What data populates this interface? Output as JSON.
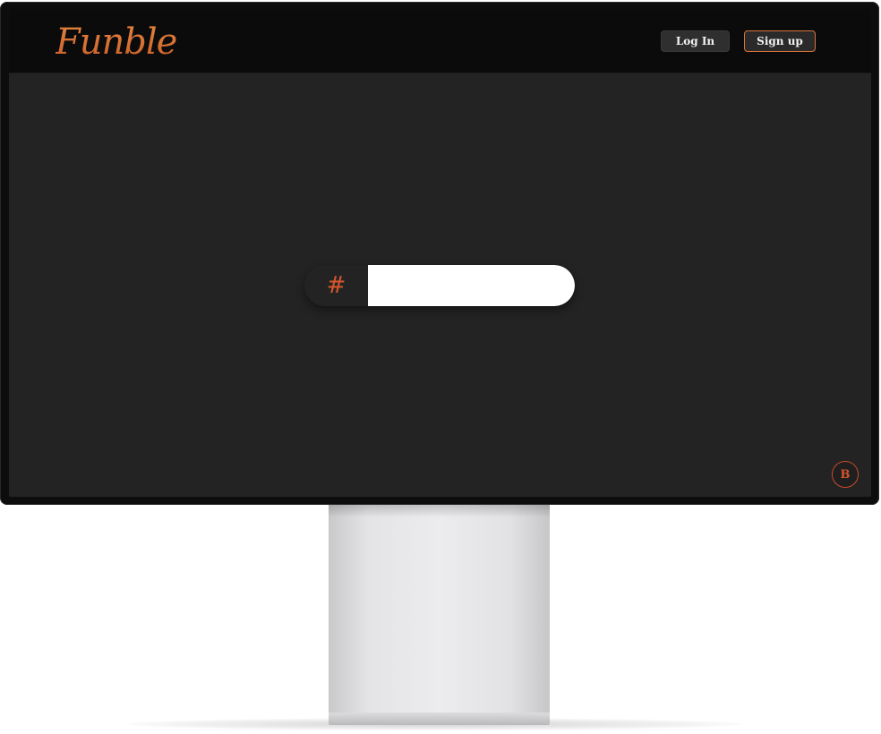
{
  "navbar": {
    "logo_text": "Funble",
    "login_label": "Log In",
    "signup_label": "Sign up"
  },
  "hashtag_search": {
    "prefix_symbol": "#",
    "value": "",
    "placeholder": ""
  },
  "badge": {
    "label": "B"
  },
  "colors": {
    "accent": "#d9743a",
    "accent_red": "#d4552c",
    "navbar_bg": "#0b0b0b",
    "screen_bg": "#232323",
    "button_bg": "#2f2f2f"
  },
  "icons": {
    "hashtag": "hash-icon",
    "badge": "b-badge-icon"
  }
}
